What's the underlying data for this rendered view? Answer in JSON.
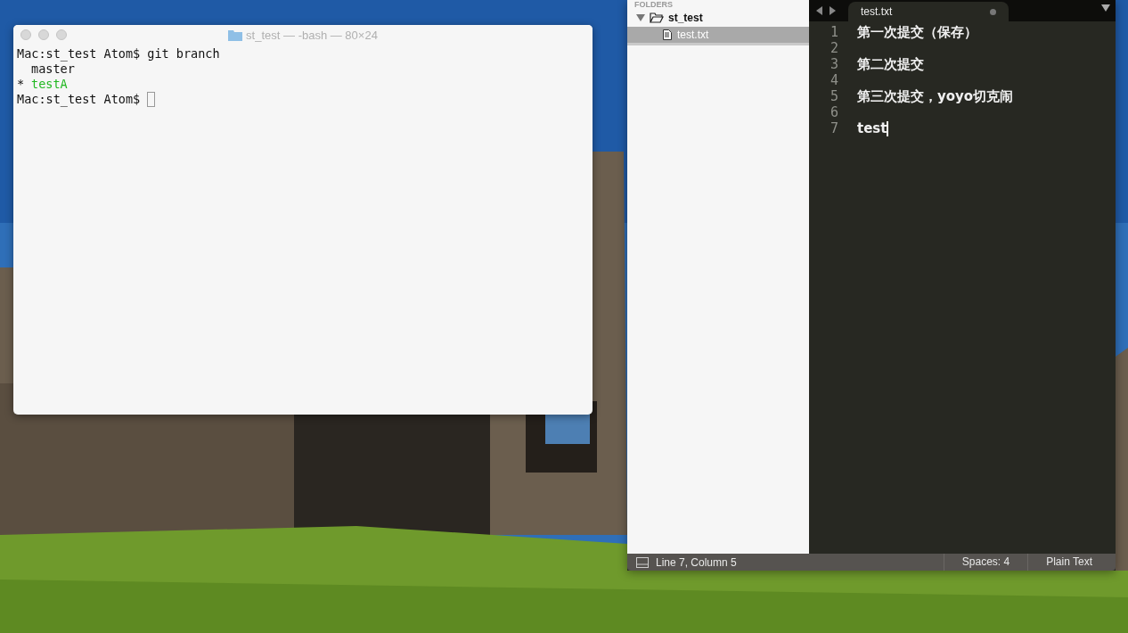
{
  "terminal": {
    "title": "st_test — -bash — 80×24",
    "lines": [
      {
        "kind": "prompt",
        "text": "Mac:st_test Atom$ git branch"
      },
      {
        "kind": "branch",
        "name": "master",
        "selected": false
      },
      {
        "kind": "branch",
        "marker": "*",
        "name": "testA",
        "selected": true
      },
      {
        "kind": "prompt",
        "text": "Mac:st_test Atom$",
        "cursor": true
      }
    ]
  },
  "editor": {
    "sidebar": {
      "header": "FOLDERS",
      "folders": [
        {
          "name": "st_test",
          "expanded": true,
          "children": [
            {
              "name": "test.txt",
              "selected": true
            }
          ]
        }
      ]
    },
    "tabs": [
      {
        "label": "test.txt",
        "selected": true,
        "modified": true
      }
    ],
    "lines": [
      {
        "number": "1",
        "text": "第一次提交（保存）"
      },
      {
        "number": "2"
      },
      {
        "number": "3",
        "text": "第二次提交"
      },
      {
        "number": "4"
      },
      {
        "number": "5",
        "text": "第三次提交，yoyo切克闹"
      },
      {
        "number": "6"
      },
      {
        "number": "7",
        "text": "test",
        "cursor": true
      }
    ],
    "status_bar": {
      "position": "Line 7, Column 5",
      "indentation": "Spaces: 4",
      "syntax": "Plain Text"
    }
  }
}
